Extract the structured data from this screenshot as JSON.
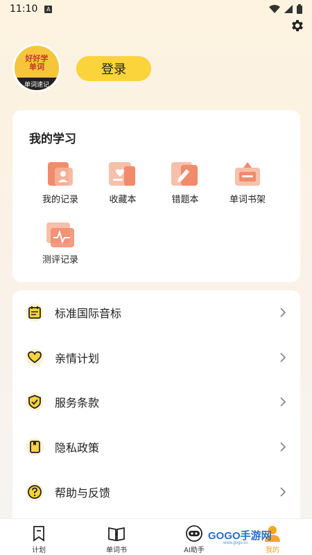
{
  "status": {
    "time": "11:10",
    "a_icon_text": "A"
  },
  "header": {
    "login_label": "登录",
    "avatar_top": "好好学\n单词",
    "avatar_band": "单词速记"
  },
  "study": {
    "title": "我的学习",
    "items": [
      {
        "label": "我的记录",
        "icon": "record-icon"
      },
      {
        "label": "收藏本",
        "icon": "favorites-icon"
      },
      {
        "label": "错题本",
        "icon": "mistakes-icon"
      },
      {
        "label": "单词书架",
        "icon": "bookshelf-icon"
      },
      {
        "label": "测评记录",
        "icon": "assessment-icon"
      }
    ]
  },
  "menu": {
    "items": [
      {
        "label": "标准国际音标",
        "icon": "calendar-icon"
      },
      {
        "label": "亲情计划",
        "icon": "heart-icon"
      },
      {
        "label": "服务条款",
        "icon": "shield-check-icon"
      },
      {
        "label": "隐私政策",
        "icon": "book-icon"
      },
      {
        "label": "帮助与反馈",
        "icon": "question-icon"
      }
    ]
  },
  "tabbar": {
    "items": [
      {
        "label": "计划",
        "icon": "bookmark-icon"
      },
      {
        "label": "单词书",
        "icon": "open-book-icon"
      },
      {
        "label": "AI助手",
        "icon": "robot-icon"
      },
      {
        "label": "我的",
        "icon": "person-icon"
      }
    ],
    "active": "我的"
  },
  "watermark": {
    "text": "GOGO手游网",
    "sub": "www.gogo.cn"
  },
  "colors": {
    "accent": "#fbd33b",
    "icon_dark": "#222222",
    "study_icon": "#f28b6b"
  }
}
